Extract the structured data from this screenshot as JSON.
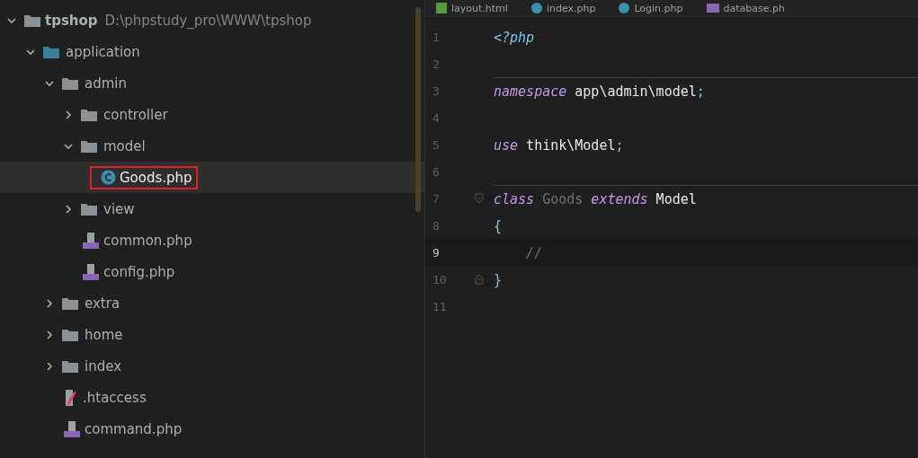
{
  "project_tree": {
    "root": {
      "name": "tpshop",
      "path": "D:\\phpstudy_pro\\WWW\\tpshop",
      "expanded": true,
      "children": [
        {
          "name": "application",
          "kind": "module",
          "expanded": true,
          "children": [
            {
              "name": "admin",
              "kind": "folder",
              "expanded": true,
              "children": [
                {
                  "name": "controller",
                  "kind": "folder",
                  "expanded": false
                },
                {
                  "name": "model",
                  "kind": "folder",
                  "expanded": true,
                  "children": [
                    {
                      "name": "Goods.php",
                      "kind": "class",
                      "selected": true
                    }
                  ]
                },
                {
                  "name": "view",
                  "kind": "folder",
                  "expanded": false
                },
                {
                  "name": "common.php",
                  "kind": "php",
                  "selected": false
                },
                {
                  "name": "config.php",
                  "kind": "php",
                  "selected": false
                }
              ]
            },
            {
              "name": "extra",
              "kind": "folder",
              "expanded": false
            },
            {
              "name": "home",
              "kind": "folder",
              "expanded": false
            },
            {
              "name": "index",
              "kind": "folder",
              "expanded": false
            },
            {
              "name": ".htaccess",
              "kind": "htaccess",
              "selected": false
            },
            {
              "name": "command.php",
              "kind": "php",
              "selected": false
            }
          ]
        }
      ]
    }
  },
  "editor_tabs": [
    {
      "label": "layout.html",
      "kind": "html"
    },
    {
      "label": "index.php",
      "kind": "class"
    },
    {
      "label": "Login.php",
      "kind": "class"
    },
    {
      "label": "database.ph",
      "kind": "php"
    }
  ],
  "editor": {
    "lines": [
      {
        "number": "1",
        "current": false,
        "separator_above": false,
        "tokens": [
          {
            "text": "<?php",
            "kind": "tag"
          }
        ]
      },
      {
        "number": "2",
        "current": false,
        "separator_above": false
      },
      {
        "number": "3",
        "current": false,
        "separator_above": true,
        "tokens": [
          {
            "text": "namespace",
            "kind": "keyword"
          },
          {
            "text": " app\\admin\\model",
            "kind": "plain"
          },
          {
            "text": ";",
            "kind": "punct"
          }
        ]
      },
      {
        "number": "4",
        "current": false,
        "separator_above": false
      },
      {
        "number": "5",
        "current": false,
        "separator_above": false,
        "tokens": [
          {
            "text": "use",
            "kind": "keyword"
          },
          {
            "text": " think\\Model",
            "kind": "plain"
          },
          {
            "text": ";",
            "kind": "punct"
          }
        ]
      },
      {
        "number": "6",
        "current": false,
        "separator_above": false
      },
      {
        "number": "7",
        "current": false,
        "separator_above": true,
        "fold_start": true,
        "tokens": [
          {
            "text": "class",
            "kind": "keyword"
          },
          {
            "text": " Goods",
            "kind": "unused"
          },
          {
            "text": " extends",
            "kind": "keyword"
          },
          {
            "text": " Model",
            "kind": "plain"
          }
        ]
      },
      {
        "number": "8",
        "current": false,
        "separator_above": false,
        "tokens": [
          {
            "text": "{",
            "kind": "punct"
          }
        ]
      },
      {
        "number": "9",
        "current": true,
        "separator_above": false,
        "tokens": [
          {
            "text": "    //",
            "kind": "comment"
          }
        ]
      },
      {
        "number": "10",
        "current": false,
        "separator_above": false,
        "fold_end": true,
        "tokens": [
          {
            "text": "}",
            "kind": "punct"
          }
        ]
      },
      {
        "number": "11",
        "current": false,
        "separator_above": false
      }
    ]
  }
}
